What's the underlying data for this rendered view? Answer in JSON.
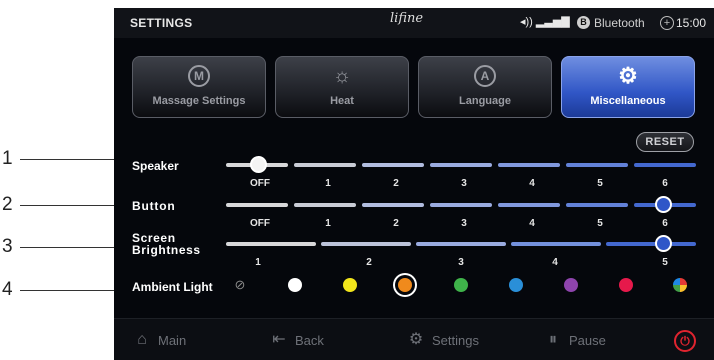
{
  "callouts": [
    "1",
    "2",
    "3",
    "4"
  ],
  "statusbar": {
    "title": "SETTINGS",
    "logo": "lifine",
    "bluetooth_label": "Bluetooth",
    "time": "15:00"
  },
  "tabs": [
    {
      "label": "Massage Settings",
      "icon_glyph": "M",
      "icon": "massage-icon",
      "active": false
    },
    {
      "label": "Heat",
      "icon_glyph": "☼",
      "icon": "sun-icon",
      "active": false
    },
    {
      "label": "Language",
      "icon_glyph": "A",
      "icon": "language-icon",
      "active": false
    },
    {
      "label": "Miscellaneous",
      "icon_glyph": "⚙",
      "icon": "gear-icon",
      "active": true
    }
  ],
  "reset_label": "RESET",
  "speaker": {
    "label": "Speaker",
    "ticks": [
      "OFF",
      "1",
      "2",
      "3",
      "4",
      "5",
      "6"
    ],
    "selected_level": "OFF"
  },
  "button": {
    "label": "Button",
    "ticks": [
      "OFF",
      "1",
      "2",
      "3",
      "4",
      "5",
      "6"
    ],
    "selected_level": "6"
  },
  "brightness": {
    "label_line1": "Screen",
    "label_line2": "Brightness",
    "ticks": [
      "1",
      "2",
      "3",
      "4",
      "5"
    ],
    "selected_level": "5"
  },
  "ambient": {
    "label": "Ambient Light",
    "off_glyph": "⊘",
    "colors": [
      "#ffffff",
      "#f2e51b",
      "#f08a1c",
      "#3fb34a",
      "#2a8fd8",
      "#8e44ad",
      "#e6194b"
    ],
    "selected_index": 2
  },
  "navbar": {
    "main": "Main",
    "back": "Back",
    "settings": "Settings",
    "pause": "Pause"
  }
}
